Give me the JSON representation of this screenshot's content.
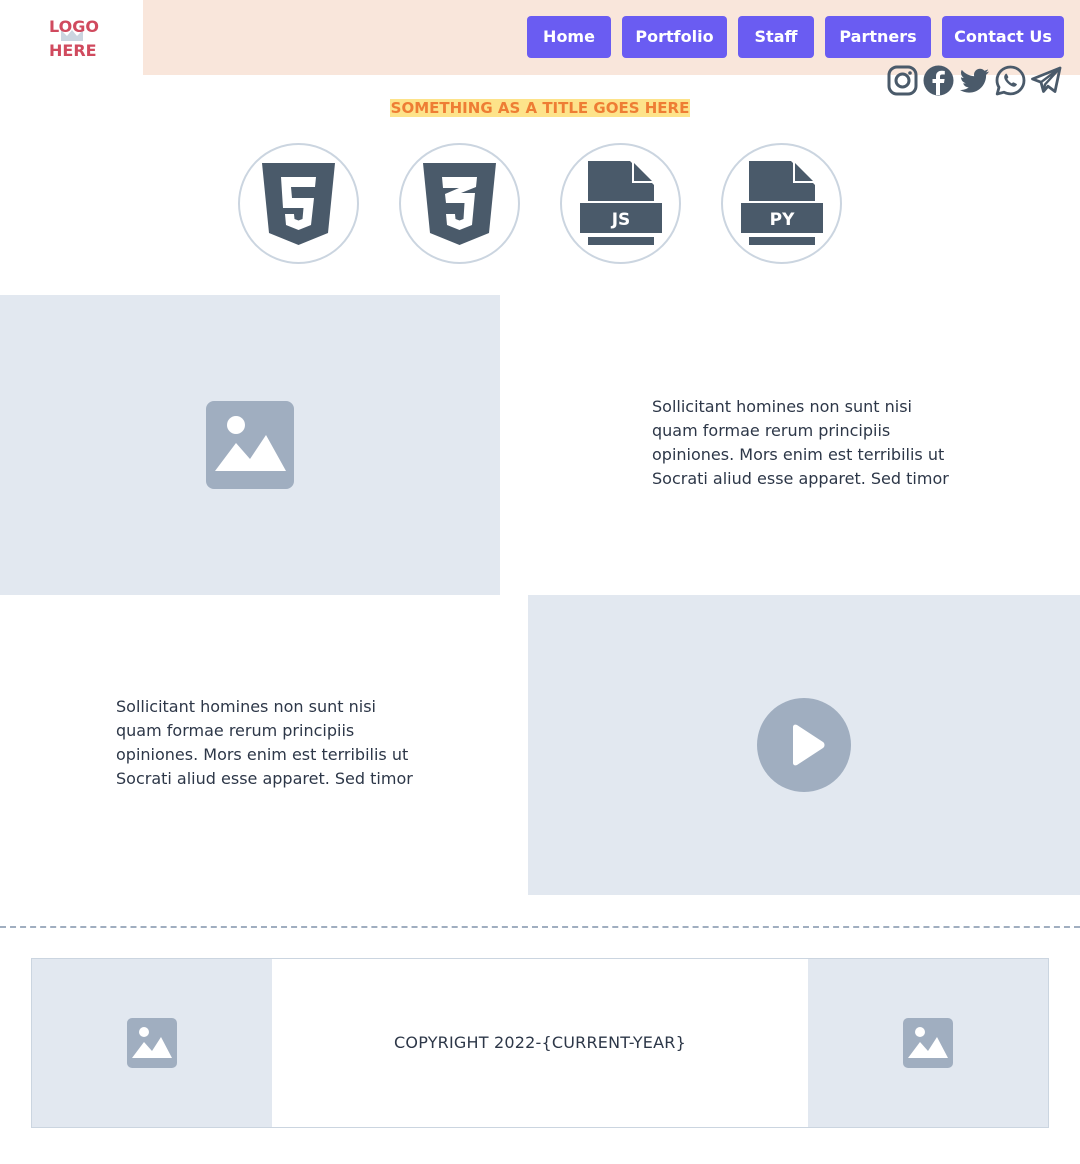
{
  "header": {
    "logo_line1": "LOGO",
    "logo_line2": "HERE",
    "nav": [
      "Home",
      "Portfolio",
      "Staff",
      "Partners",
      "Contact Us"
    ]
  },
  "social_icons": [
    "instagram-icon",
    "facebook-icon",
    "twitter-icon",
    "whatsapp-icon",
    "telegram-icon"
  ],
  "title": "SOMETHING AS A TITLE GOES HERE",
  "tech_icons": [
    {
      "icon": "html5-icon",
      "label": ""
    },
    {
      "icon": "css3-icon",
      "label": ""
    },
    {
      "icon": "js-file-icon",
      "label": "JS"
    },
    {
      "icon": "py-file-icon",
      "label": "PY"
    }
  ],
  "section1": {
    "text": "Sollicitant homines non sunt nisi quam formae rerum principiis opiniones. Mors enim est terribilis ut Socrati aliud esse apparet. Sed timor"
  },
  "section2": {
    "text": "Sollicitant homines non sunt nisi quam formae rerum principiis opiniones. Mors enim est terribilis ut Socrati aliud esse apparet. Sed timor"
  },
  "footer": {
    "copyright": "COPYRIGHT 2022-{CURRENT-YEAR}"
  },
  "colors": {
    "header_bg": "#f9e6db",
    "nav_button": "#6a5cf2",
    "logo": "#d04a5e",
    "title_text": "#ee7d34",
    "title_highlight": "#fde38a",
    "placeholder_bg": "#e2e8f0",
    "icon_gray": "#a0aec0",
    "icon_dark": "#4a5a6a"
  }
}
